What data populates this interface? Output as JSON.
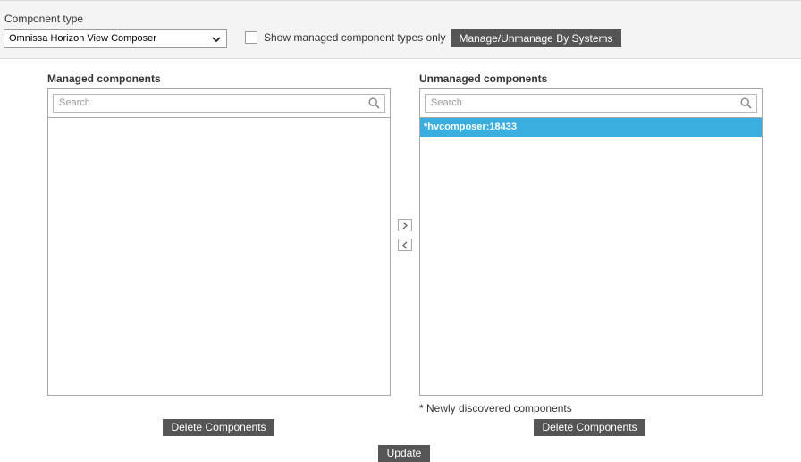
{
  "header": {
    "component_type_label": "Component type",
    "component_type_value": "Omnissa Horizon View Composer",
    "show_managed_label": "Show managed component types only",
    "manage_button": "Manage/Unmanage By Systems"
  },
  "managed": {
    "title": "Managed components",
    "search_placeholder": "Search",
    "items": [],
    "delete_button": "Delete Components"
  },
  "unmanaged": {
    "title": "Unmanaged components",
    "search_placeholder": "Search",
    "items": [
      {
        "label": "*hvcomposer:18433",
        "selected": true
      }
    ],
    "delete_button": "Delete Components"
  },
  "note": "* Newly discovered components",
  "update_button": "Update",
  "colors": {
    "button_bg": "#555555",
    "selection": "#3aaede",
    "top_bar_bg": "#f4f4f4"
  },
  "icons": {
    "move_right": "chevron-right-icon",
    "move_left": "chevron-left-icon",
    "search": "search-icon",
    "dropdown": "chevron-down-icon"
  }
}
